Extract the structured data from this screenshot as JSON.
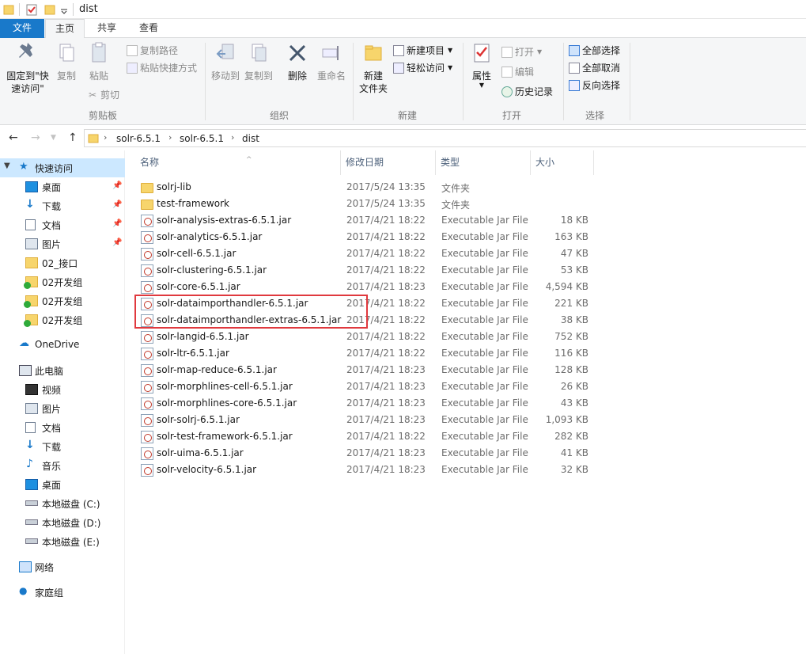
{
  "window": {
    "title": "dist"
  },
  "tabs": {
    "file": "文件",
    "home": "主页",
    "share": "共享",
    "view": "查看"
  },
  "ribbon": {
    "clipboard": {
      "group": "剪贴板",
      "pin_line1": "固定到\"快",
      "pin_line2": "速访问\"",
      "copy": "复制",
      "paste": "粘贴",
      "copy_path": "复制路径",
      "paste_shortcut": "粘贴快捷方式",
      "cut": "剪切"
    },
    "organize": {
      "group": "组织",
      "move_to": "移动到",
      "copy_to": "复制到",
      "delete": "删除",
      "rename": "重命名"
    },
    "new": {
      "group": "新建",
      "new_folder_line1": "新建",
      "new_folder_line2": "文件夹",
      "new_item": "新建项目",
      "easy_access": "轻松访问"
    },
    "open": {
      "group": "打开",
      "properties": "属性",
      "open": "打开",
      "edit": "编辑",
      "history": "历史记录"
    },
    "select": {
      "group": "选择",
      "select_all": "全部选择",
      "select_none": "全部取消",
      "invert": "反向选择"
    }
  },
  "address": {
    "crumbs": [
      "solr-6.5.1",
      "solr-6.5.1",
      "dist"
    ]
  },
  "sidebar": {
    "quick_access": "快速访问",
    "quick_items": [
      "桌面",
      "下载",
      "文档",
      "图片",
      "02_接口",
      "02开发组",
      "02开发组",
      "02开发组"
    ],
    "onedrive": "OneDrive",
    "this_pc": "此电脑",
    "pc_items": [
      "视频",
      "图片",
      "文档",
      "下载",
      "音乐",
      "桌面",
      "本地磁盘 (C:)",
      "本地磁盘 (D:)",
      "本地磁盘 (E:)"
    ],
    "network": "网络",
    "homegroup": "家庭组"
  },
  "columns": {
    "name": "名称",
    "date": "修改日期",
    "type": "类型",
    "size": "大小"
  },
  "files": [
    {
      "name": "solrj-lib",
      "date": "2017/5/24 13:35",
      "type": "文件夹",
      "size": "",
      "kind": "folder"
    },
    {
      "name": "test-framework",
      "date": "2017/5/24 13:35",
      "type": "文件夹",
      "size": "",
      "kind": "folder"
    },
    {
      "name": "solr-analysis-extras-6.5.1.jar",
      "date": "2017/4/21 18:22",
      "type": "Executable Jar File",
      "size": "18 KB",
      "kind": "jar"
    },
    {
      "name": "solr-analytics-6.5.1.jar",
      "date": "2017/4/21 18:22",
      "type": "Executable Jar File",
      "size": "163 KB",
      "kind": "jar"
    },
    {
      "name": "solr-cell-6.5.1.jar",
      "date": "2017/4/21 18:22",
      "type": "Executable Jar File",
      "size": "47 KB",
      "kind": "jar"
    },
    {
      "name": "solr-clustering-6.5.1.jar",
      "date": "2017/4/21 18:22",
      "type": "Executable Jar File",
      "size": "53 KB",
      "kind": "jar"
    },
    {
      "name": "solr-core-6.5.1.jar",
      "date": "2017/4/21 18:23",
      "type": "Executable Jar File",
      "size": "4,594 KB",
      "kind": "jar"
    },
    {
      "name": "solr-dataimporthandler-6.5.1.jar",
      "date": "2017/4/21 18:22",
      "type": "Executable Jar File",
      "size": "221 KB",
      "kind": "jar"
    },
    {
      "name": "solr-dataimporthandler-extras-6.5.1.jar",
      "date": "2017/4/21 18:22",
      "type": "Executable Jar File",
      "size": "38 KB",
      "kind": "jar"
    },
    {
      "name": "solr-langid-6.5.1.jar",
      "date": "2017/4/21 18:22",
      "type": "Executable Jar File",
      "size": "752 KB",
      "kind": "jar"
    },
    {
      "name": "solr-ltr-6.5.1.jar",
      "date": "2017/4/21 18:22",
      "type": "Executable Jar File",
      "size": "116 KB",
      "kind": "jar"
    },
    {
      "name": "solr-map-reduce-6.5.1.jar",
      "date": "2017/4/21 18:23",
      "type": "Executable Jar File",
      "size": "128 KB",
      "kind": "jar"
    },
    {
      "name": "solr-morphlines-cell-6.5.1.jar",
      "date": "2017/4/21 18:23",
      "type": "Executable Jar File",
      "size": "26 KB",
      "kind": "jar"
    },
    {
      "name": "solr-morphlines-core-6.5.1.jar",
      "date": "2017/4/21 18:23",
      "type": "Executable Jar File",
      "size": "43 KB",
      "kind": "jar"
    },
    {
      "name": "solr-solrj-6.5.1.jar",
      "date": "2017/4/21 18:23",
      "type": "Executable Jar File",
      "size": "1,093 KB",
      "kind": "jar"
    },
    {
      "name": "solr-test-framework-6.5.1.jar",
      "date": "2017/4/21 18:22",
      "type": "Executable Jar File",
      "size": "282 KB",
      "kind": "jar"
    },
    {
      "name": "solr-uima-6.5.1.jar",
      "date": "2017/4/21 18:23",
      "type": "Executable Jar File",
      "size": "41 KB",
      "kind": "jar"
    },
    {
      "name": "solr-velocity-6.5.1.jar",
      "date": "2017/4/21 18:23",
      "type": "Executable Jar File",
      "size": "32 KB",
      "kind": "jar"
    }
  ],
  "colors": {
    "accent": "#1979ca",
    "selection": "#cce8ff",
    "highlight_box": "#e0393e"
  }
}
